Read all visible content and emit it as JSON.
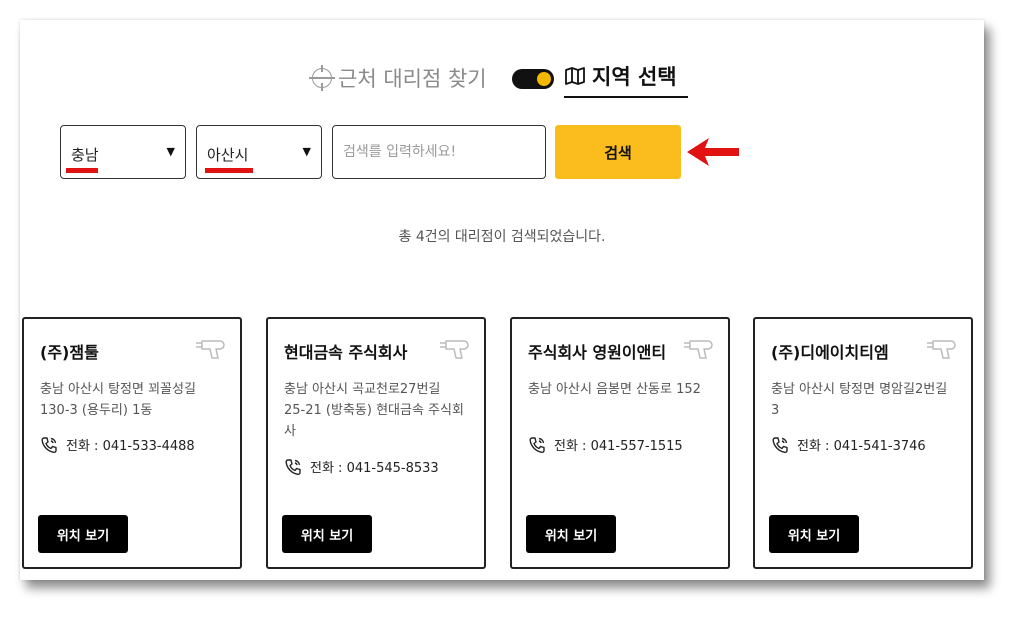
{
  "tabs": {
    "nearby_label": "근처 대리점 찾기",
    "region_label": "지역 선택"
  },
  "search": {
    "province": "충남",
    "city": "아산시",
    "placeholder": "검색를 입력하세요!",
    "button_label": "검색"
  },
  "result_text": "총 4건의 대리점이 검색되었습니다.",
  "colors": {
    "accent": "#fbbd1e",
    "annotation": "#e01212"
  },
  "dealers": [
    {
      "name": "(주)잼툴",
      "address": "충남 아산시 탕정면 꾀꼴성길 130-3 (용두리) 1동",
      "phone": "전화 : 041-533-4488",
      "button": "위치 보기"
    },
    {
      "name": "현대금속 주식회사",
      "address": "충남 아산시 곡교천로27번길 25-21 (방축동) 현대금속 주식회사",
      "phone": "전화 : 041-545-8533",
      "button": "위치 보기"
    },
    {
      "name": "주식회사 영원이앤티",
      "address": "충남 아산시 음봉면 산동로 152",
      "phone": "전화 : 041-557-1515",
      "button": "위치 보기"
    },
    {
      "name": "(주)디에이치티엠",
      "address": "충남 아산시 탕정면 명암길2번길 3",
      "phone": "전화 : 041-541-3746",
      "button": "위치 보기"
    }
  ]
}
